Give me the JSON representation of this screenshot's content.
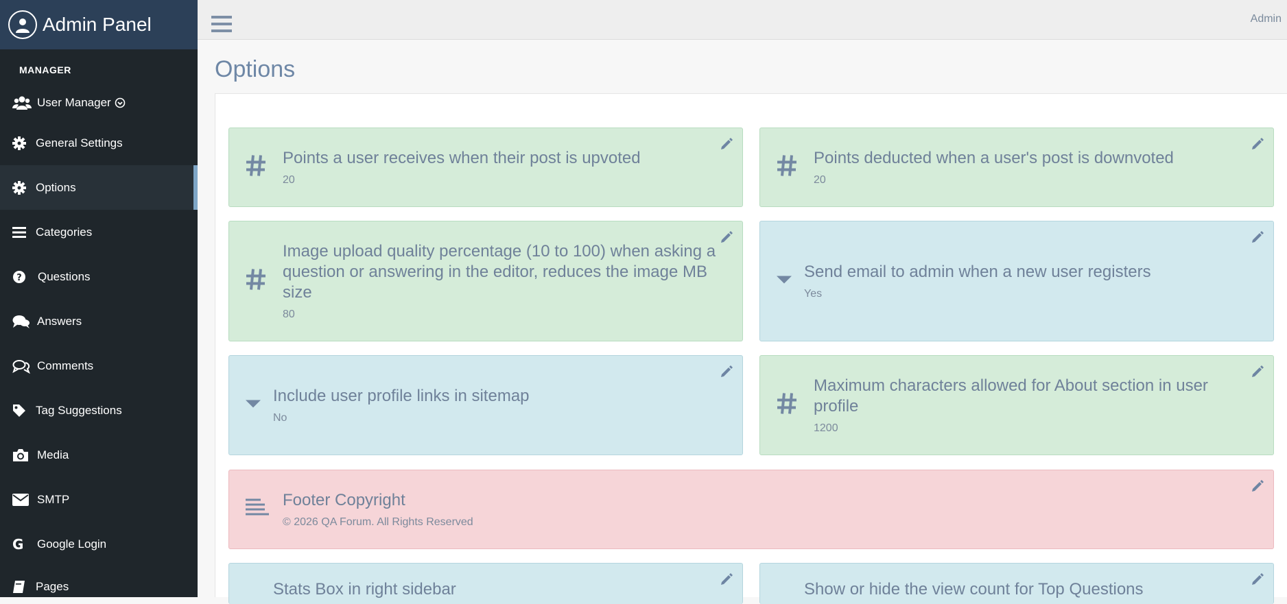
{
  "brand": {
    "title": "Admin Panel"
  },
  "sidebar": {
    "section": "MANAGER",
    "items": [
      {
        "label": "User Manager",
        "icon": "users-icon"
      },
      {
        "label": "General Settings",
        "icon": "gear-icon"
      },
      {
        "label": "Options",
        "icon": "gear-icon",
        "active": true
      },
      {
        "label": "Categories",
        "icon": "list-icon"
      },
      {
        "label": "Questions",
        "icon": "question-circle-icon"
      },
      {
        "label": "Answers",
        "icon": "chat-icon"
      },
      {
        "label": "Comments",
        "icon": "comments-icon"
      },
      {
        "label": "Tag Suggestions",
        "icon": "tag-icon"
      },
      {
        "label": "Media",
        "icon": "camera-icon"
      },
      {
        "label": "SMTP",
        "icon": "envelope-icon"
      },
      {
        "label": "Google Login",
        "icon": "google-icon"
      },
      {
        "label": "Pages",
        "icon": "book-icon"
      }
    ]
  },
  "topbar": {
    "user": "Admin"
  },
  "page": {
    "title": "Options"
  },
  "options": [
    {
      "title": "Points a user receives when their post is upvoted",
      "value": "20",
      "type": "number"
    },
    {
      "title": "Points deducted when a user's post is downvoted",
      "value": "20",
      "type": "number"
    },
    {
      "title": "Image upload quality percentage (10 to 100) when asking a question or answering in the editor, reduces the image MB size",
      "value": "80",
      "type": "number"
    },
    {
      "title": "Send email to admin when a new user registers",
      "value": "Yes",
      "type": "select"
    },
    {
      "title": "Include user profile links in sitemap",
      "value": "No",
      "type": "select"
    },
    {
      "title": "Maximum characters allowed for About section in user profile",
      "value": "1200",
      "type": "number"
    },
    {
      "title": "Footer Copyright",
      "value": "© 2026 QA Forum. All Rights Reserved",
      "type": "text"
    },
    {
      "title": "Stats Box in right sidebar",
      "value": "",
      "type": "select"
    },
    {
      "title": "Show or hide the view count for Top Questions",
      "value": "",
      "type": "select"
    }
  ],
  "colors": {
    "sidebar": "#1f262b",
    "brand": "#2c4058",
    "number_card": "#d5ecd9",
    "select_card": "#d2e9ee",
    "text_card": "#f6d5d8"
  }
}
